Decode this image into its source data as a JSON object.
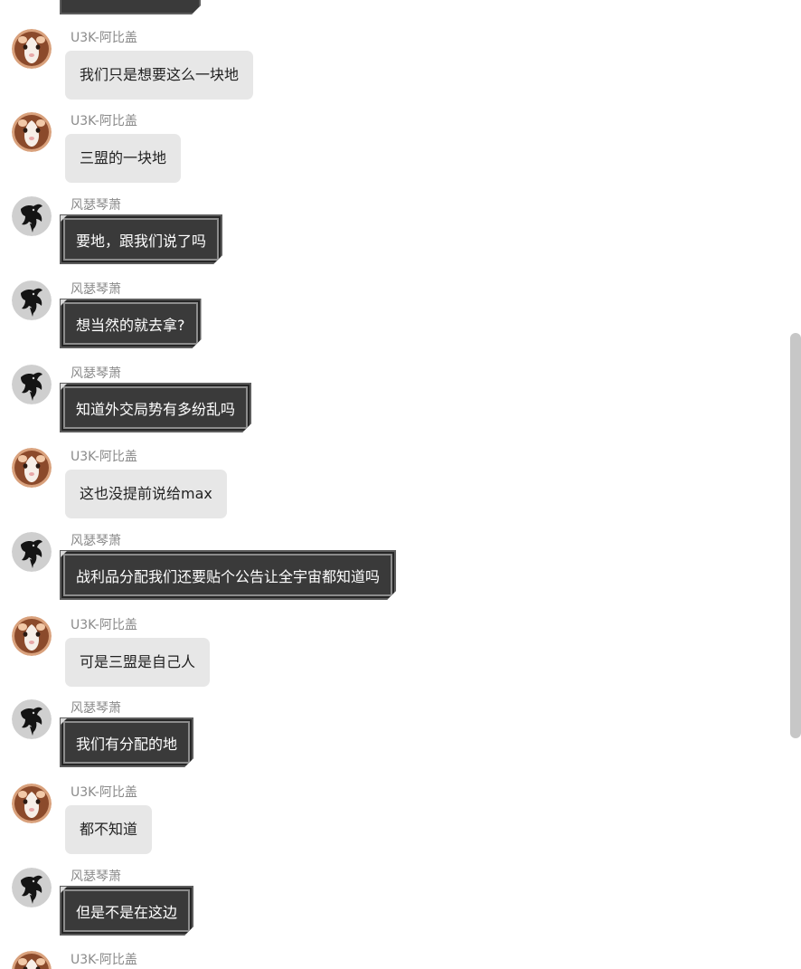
{
  "users": {
    "guinea": {
      "name": "U3K-阿比盖",
      "avatar_icon": "guinea-pig-avatar-icon"
    },
    "bird": {
      "name": "风瑟琴萧",
      "avatar_icon": "black-bird-avatar-icon"
    }
  },
  "messages": [
    {
      "user": "guinea",
      "name": "U3K-阿比盖",
      "text": "我们只是想要这么一块地"
    },
    {
      "user": "guinea",
      "name": "U3K-阿比盖",
      "text": "三盟的一块地"
    },
    {
      "user": "bird",
      "name": "风瑟琴萧",
      "text": "要地，跟我们说了吗"
    },
    {
      "user": "bird",
      "name": "风瑟琴萧",
      "text": "想当然的就去拿?"
    },
    {
      "user": "bird",
      "name": "风瑟琴萧",
      "text": "知道外交局势有多纷乱吗"
    },
    {
      "user": "guinea",
      "name": "U3K-阿比盖",
      "text": "这也没提前说给max"
    },
    {
      "user": "bird",
      "name": "风瑟琴萧",
      "text": "战利品分配我们还要贴个公告让全宇宙都知道吗"
    },
    {
      "user": "guinea",
      "name": "U3K-阿比盖",
      "text": "可是三盟是自己人"
    },
    {
      "user": "bird",
      "name": "风瑟琴萧",
      "text": "我们有分配的地"
    },
    {
      "user": "guinea",
      "name": "U3K-阿比盖",
      "text": "都不知道"
    },
    {
      "user": "bird",
      "name": "风瑟琴萧",
      "text": "但是不是在这边"
    },
    {
      "user": "guinea",
      "name": "U3K-阿比盖",
      "text": ""
    }
  ],
  "colors": {
    "light_bubble": "#e7e7e7",
    "dark_bubble": "#3a3a3a",
    "name_text": "#8a8a8a",
    "scrollbar": "#c7c7c7"
  }
}
